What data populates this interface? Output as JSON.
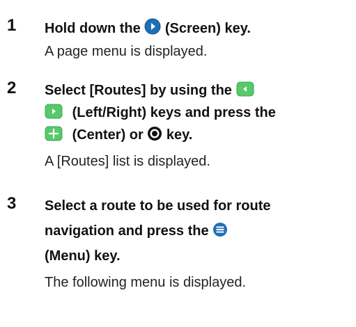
{
  "steps": [
    {
      "number": "1",
      "instruction": {
        "prefix": "Hold down the",
        "icon": "screen-key-icon",
        "suffix": "(Screen) key."
      },
      "result": "A page menu is displayed."
    },
    {
      "number": "2",
      "instruction": {
        "line1_prefix": "Select [Routes] by using the",
        "line1_icon": "left-key-icon",
        "line2_icon": "right-key-icon",
        "line2_text": "(Left/Right) keys and press the",
        "line3_icon": "center-key-icon",
        "line3_text_a": "(Center) or",
        "line3_icon2": "enter-key-icon",
        "line3_text_b": "key."
      },
      "result": "A [Routes] list is displayed."
    },
    {
      "number": "3",
      "instruction": {
        "line1": "Select a route to be used for route",
        "line2_prefix": "navigation and press the",
        "line2_icon": "menu-key-icon",
        "line3": "(Menu) key."
      },
      "result": "The following menu is displayed."
    }
  ],
  "colors": {
    "screen_key": "#1f6fb5",
    "left_right_keys": "#57c96a",
    "center_key": "#57c96a",
    "enter_key": "#111111",
    "menu_key": "#1f6fb5"
  }
}
